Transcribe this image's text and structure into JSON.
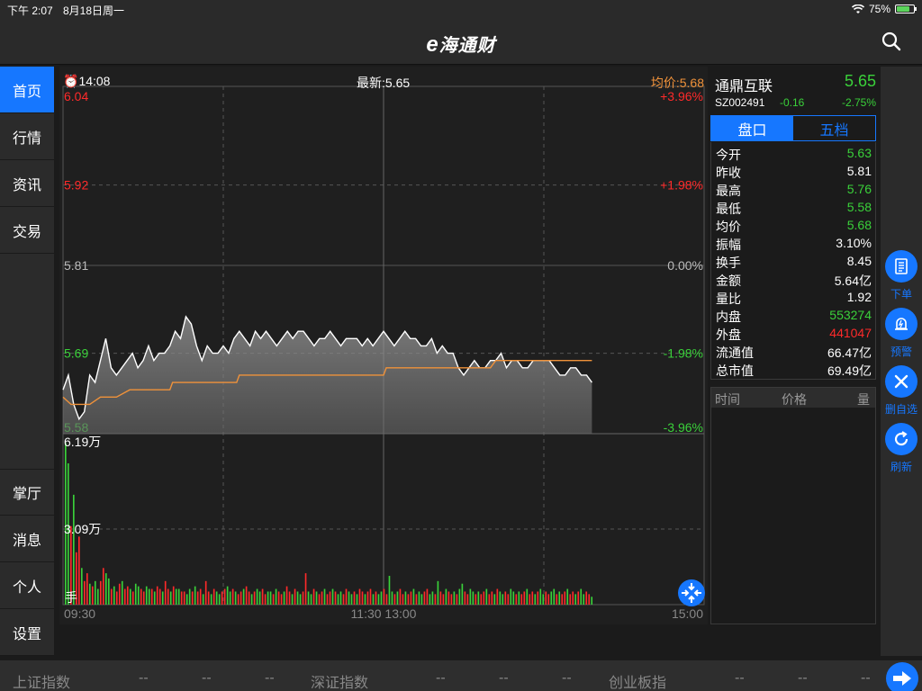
{
  "status": {
    "time": "下午 2:07",
    "date": "8月18日周一",
    "battery": "75%"
  },
  "app": {
    "logo_prefix": "e",
    "logo_text": "海通财"
  },
  "sidebar": {
    "top": [
      {
        "label": "首页"
      },
      {
        "label": "行情"
      },
      {
        "label": "资讯"
      },
      {
        "label": "交易"
      }
    ],
    "bottom": [
      {
        "label": "掌厅"
      },
      {
        "label": "消息"
      },
      {
        "label": "个人"
      },
      {
        "label": "设置"
      }
    ]
  },
  "chart_header": {
    "time": "14:08",
    "latest": "最新:5.65",
    "avg": "均价:5.68"
  },
  "colors": {
    "up": "#ff2a2a",
    "down": "#3ad13a",
    "accent": "#1677ff",
    "avg_line": "#f0923a"
  },
  "chart_data": {
    "type": "line",
    "price_axis": [
      {
        "price": "6.04",
        "pct": "+3.96%",
        "color": "up"
      },
      {
        "price": "5.92",
        "pct": "+1.98%",
        "color": "up"
      },
      {
        "price": "5.81",
        "pct": "0.00%",
        "color": "neutral"
      },
      {
        "price": "5.69",
        "pct": "-1.98%",
        "color": "down"
      },
      {
        "price": "5.58",
        "pct": "-3.96%",
        "color": "down"
      }
    ],
    "ylim": [
      5.58,
      6.04
    ],
    "prev_close": 5.81,
    "x_labels": {
      "start": "09:30",
      "mid": "11:30 13:00",
      "end": "15:00"
    },
    "total_minutes": 240,
    "price_series": [
      [
        0,
        5.64
      ],
      [
        2,
        5.66
      ],
      [
        4,
        5.62
      ],
      [
        6,
        5.6
      ],
      [
        8,
        5.61
      ],
      [
        10,
        5.66
      ],
      [
        12,
        5.65
      ],
      [
        14,
        5.68
      ],
      [
        16,
        5.71
      ],
      [
        18,
        5.67
      ],
      [
        20,
        5.66
      ],
      [
        24,
        5.68
      ],
      [
        26,
        5.69
      ],
      [
        28,
        5.67
      ],
      [
        30,
        5.68
      ],
      [
        32,
        5.7
      ],
      [
        34,
        5.68
      ],
      [
        36,
        5.69
      ],
      [
        38,
        5.69
      ],
      [
        40,
        5.7
      ],
      [
        42,
        5.72
      ],
      [
        44,
        5.71
      ],
      [
        46,
        5.74
      ],
      [
        48,
        5.73
      ],
      [
        50,
        5.7
      ],
      [
        52,
        5.68
      ],
      [
        54,
        5.7
      ],
      [
        56,
        5.69
      ],
      [
        58,
        5.69
      ],
      [
        60,
        5.7
      ],
      [
        62,
        5.69
      ],
      [
        64,
        5.71
      ],
      [
        66,
        5.72
      ],
      [
        68,
        5.71
      ],
      [
        70,
        5.7
      ],
      [
        72,
        5.72
      ],
      [
        74,
        5.71
      ],
      [
        76,
        5.72
      ],
      [
        78,
        5.71
      ],
      [
        80,
        5.7
      ],
      [
        82,
        5.71
      ],
      [
        84,
        5.72
      ],
      [
        86,
        5.71
      ],
      [
        88,
        5.72
      ],
      [
        90,
        5.72
      ],
      [
        92,
        5.71
      ],
      [
        94,
        5.7
      ],
      [
        96,
        5.71
      ],
      [
        98,
        5.71
      ],
      [
        100,
        5.72
      ],
      [
        102,
        5.71
      ],
      [
        104,
        5.7
      ],
      [
        106,
        5.71
      ],
      [
        108,
        5.71
      ],
      [
        110,
        5.71
      ],
      [
        112,
        5.7
      ],
      [
        114,
        5.71
      ],
      [
        116,
        5.7
      ],
      [
        118,
        5.71
      ],
      [
        120,
        5.72
      ],
      [
        122,
        5.71
      ],
      [
        124,
        5.7
      ],
      [
        126,
        5.71
      ],
      [
        128,
        5.72
      ],
      [
        130,
        5.71
      ],
      [
        132,
        5.71
      ],
      [
        134,
        5.7
      ],
      [
        136,
        5.7
      ],
      [
        138,
        5.71
      ],
      [
        140,
        5.69
      ],
      [
        142,
        5.7
      ],
      [
        144,
        5.69
      ],
      [
        146,
        5.69
      ],
      [
        148,
        5.67
      ],
      [
        150,
        5.66
      ],
      [
        152,
        5.67
      ],
      [
        154,
        5.68
      ],
      [
        156,
        5.67
      ],
      [
        158,
        5.67
      ],
      [
        160,
        5.68
      ],
      [
        162,
        5.68
      ],
      [
        164,
        5.69
      ],
      [
        166,
        5.67
      ],
      [
        168,
        5.68
      ],
      [
        170,
        5.68
      ],
      [
        172,
        5.67
      ],
      [
        174,
        5.67
      ],
      [
        176,
        5.68
      ],
      [
        178,
        5.68
      ],
      [
        180,
        5.68
      ],
      [
        182,
        5.68
      ],
      [
        184,
        5.67
      ],
      [
        186,
        5.66
      ],
      [
        188,
        5.66
      ],
      [
        190,
        5.67
      ],
      [
        192,
        5.67
      ],
      [
        194,
        5.66
      ],
      [
        196,
        5.66
      ],
      [
        198,
        5.65
      ]
    ],
    "avg_series": [
      [
        0,
        5.63
      ],
      [
        3,
        5.62
      ],
      [
        8,
        5.62
      ],
      [
        10,
        5.62
      ],
      [
        14,
        5.63
      ],
      [
        20,
        5.63
      ],
      [
        25,
        5.64
      ],
      [
        40,
        5.64
      ],
      [
        41,
        5.65
      ],
      [
        65,
        5.65
      ],
      [
        66,
        5.66
      ],
      [
        120,
        5.66
      ],
      [
        121,
        5.67
      ],
      [
        160,
        5.67
      ],
      [
        162,
        5.68
      ],
      [
        198,
        5.68
      ]
    ],
    "volume": {
      "labels": {
        "max": "6.19万",
        "mid": "3.09万",
        "unit": "手"
      },
      "max": 61900,
      "values": [
        61900,
        54000,
        30000,
        42000,
        20000,
        26000,
        14000,
        9000,
        12000,
        8000,
        7000,
        9000,
        6000,
        9000,
        14000,
        12000,
        10000,
        6000,
        7000,
        5000,
        8000,
        9000,
        6000,
        7000,
        6000,
        5000,
        8000,
        7000,
        6000,
        5000,
        7000,
        6000,
        6000,
        5000,
        7000,
        6000,
        5000,
        9000,
        6000,
        5000,
        7000,
        6000,
        6000,
        5000,
        5000,
        4000,
        6000,
        5000,
        7000,
        5000,
        6000,
        4000,
        9000,
        5000,
        4000,
        6000,
        5000,
        4000,
        5000,
        6000,
        7000,
        5000,
        6000,
        5000,
        4000,
        5000,
        6000,
        7000,
        5000,
        4000,
        5000,
        6000,
        5000,
        6000,
        4000,
        5000,
        5000,
        4000,
        6000,
        5000,
        4000,
        5000,
        7000,
        5000,
        4000,
        6000,
        5000,
        4000,
        5000,
        12000,
        5000,
        4000,
        6000,
        5000,
        4000,
        5000,
        6000,
        4000,
        5000,
        6000,
        5000,
        4000,
        5000,
        4000,
        6000,
        5000,
        4000,
        5000,
        4000,
        6000,
        5000,
        4000,
        5000,
        6000,
        4000,
        5000,
        4000,
        5000,
        6000,
        4000,
        11000,
        5000,
        4000,
        5000,
        6000,
        4000,
        5000,
        4000,
        5000,
        6000,
        4000,
        5000,
        4000,
        5000,
        6000,
        4000,
        5000,
        4000,
        9000,
        5000,
        4000,
        6000,
        5000,
        4000,
        5000,
        4000,
        6000,
        8000,
        5000,
        4000,
        6000,
        5000,
        4000,
        5000,
        4000,
        5000,
        6000,
        4000,
        5000,
        4000,
        6000,
        5000,
        4000,
        5000,
        4000,
        6000,
        5000,
        4000,
        5000,
        4000,
        5000,
        6000,
        4000,
        5000,
        4000,
        5000,
        6000,
        4000,
        5000,
        4000,
        5000,
        6000,
        4000,
        5000,
        4000,
        5000,
        6000,
        4000,
        5000,
        4000,
        5000,
        6000,
        4000,
        5000,
        4000,
        3000
      ]
    }
  },
  "quote": {
    "name": "通鼎互联",
    "price": "5.65",
    "code": "SZ002491",
    "change": "-0.16",
    "pct": "-2.75%",
    "tabs": [
      {
        "label": "盘口"
      },
      {
        "label": "五档"
      }
    ],
    "stats": [
      {
        "label": "今开",
        "value": "5.63",
        "color": "down"
      },
      {
        "label": "昨收",
        "value": "5.81",
        "color": "neutral"
      },
      {
        "label": "最高",
        "value": "5.76",
        "color": "down"
      },
      {
        "label": "最低",
        "value": "5.58",
        "color": "down"
      },
      {
        "label": "均价",
        "value": "5.68",
        "color": "down"
      },
      {
        "label": "振幅",
        "value": "3.10%",
        "color": "neutral"
      },
      {
        "label": "换手",
        "value": "8.45",
        "color": "neutral"
      },
      {
        "label": "金额",
        "value": "5.64亿",
        "color": "neutral"
      },
      {
        "label": "量比",
        "value": "1.92",
        "color": "neutral"
      },
      {
        "label": "内盘",
        "value": "553274",
        "color": "down"
      },
      {
        "label": "外盘",
        "value": "441047",
        "color": "up"
      },
      {
        "label": "流通值",
        "value": "66.47亿",
        "color": "neutral"
      },
      {
        "label": "总市值",
        "value": "69.49亿",
        "color": "neutral"
      }
    ],
    "ticks_header": {
      "time": "时间",
      "price": "价格",
      "volume": "量"
    }
  },
  "actions": [
    {
      "label": "下单"
    },
    {
      "label": "预警"
    },
    {
      "label": "删自选"
    },
    {
      "label": "刷新"
    }
  ],
  "ticker": {
    "items": [
      {
        "name": "上证指数",
        "v1": "--",
        "v2": "--",
        "v3": "--"
      },
      {
        "name": "深证指数",
        "v1": "--",
        "v2": "--",
        "v3": "--"
      },
      {
        "name": "创业板指",
        "v1": "--",
        "v2": "--",
        "v3": "--"
      }
    ]
  }
}
